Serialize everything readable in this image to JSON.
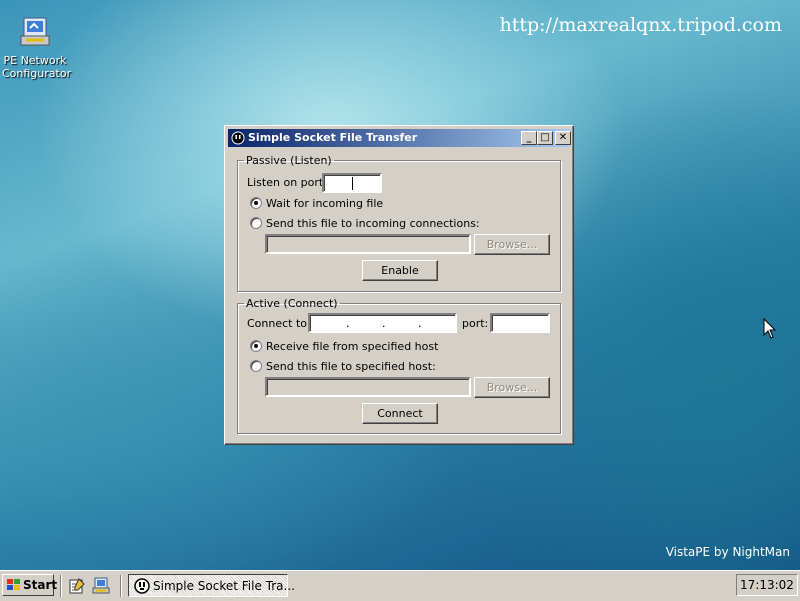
{
  "desktop": {
    "icon_label": "PE Network Configurator",
    "watermark_url": "http://maxrealqnx.tripod.com",
    "watermark_brand": "VistaPE by NightMan"
  },
  "window": {
    "title": "Simple Socket File Transfer",
    "controls": {
      "minimize": "_",
      "maximize": "□",
      "close": "✕"
    },
    "passive": {
      "legend": "Passive (Listen)",
      "listen_port_label": "Listen on port:",
      "listen_port_value": "",
      "radio_wait": "Wait for incoming file",
      "radio_wait_selected": true,
      "radio_send": "Send this file to incoming connections:",
      "radio_send_selected": false,
      "file_value": "",
      "browse_label": "Browse...",
      "enable_label": "Enable"
    },
    "active": {
      "legend": "Active (Connect)",
      "connect_label": "Connect to:",
      "ip_value": "",
      "port_label": "port:",
      "port_value": "",
      "radio_receive": "Receive file from specified host",
      "radio_receive_selected": true,
      "radio_send": "Send this file to specified host:",
      "radio_send_selected": false,
      "file_value": "",
      "browse_label": "Browse...",
      "connect_button_label": "Connect"
    }
  },
  "taskbar": {
    "start_label": "Start",
    "task_label": "Simple Socket File Tra...",
    "clock": "17:13:02"
  }
}
